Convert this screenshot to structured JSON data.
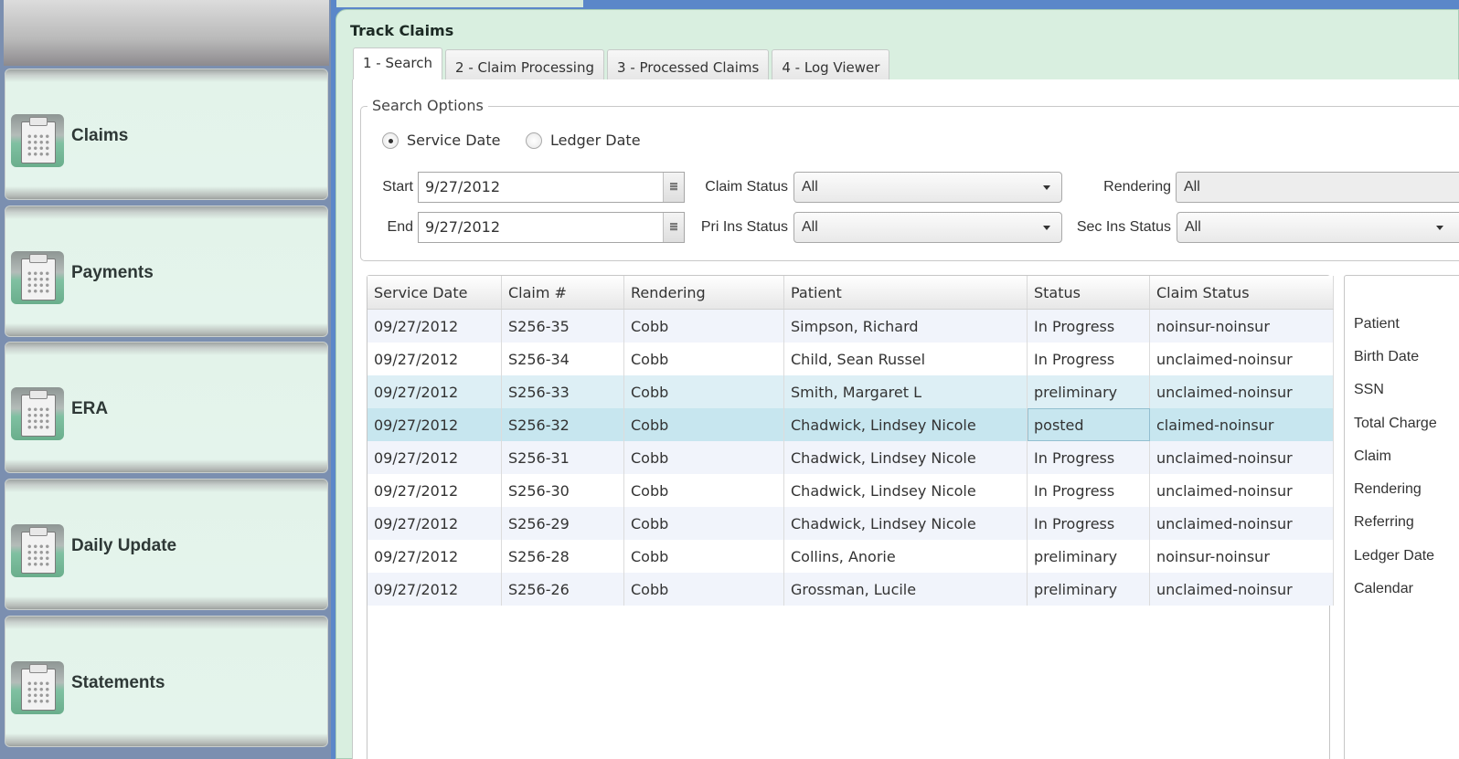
{
  "sidebar": {
    "items": [
      {
        "label": "Claims",
        "icon": "clipboard-calculator-icon"
      },
      {
        "label": "Payments",
        "icon": "clipboard-calculator-icon"
      },
      {
        "label": "ERA",
        "icon": "clipboard-calculator-icon"
      },
      {
        "label": "Daily Update",
        "icon": "clipboard-calculator-icon"
      },
      {
        "label": "Statements",
        "icon": "clipboard-calculator-icon"
      }
    ]
  },
  "panel": {
    "title": "Track Claims",
    "tabs": [
      {
        "label": "1 - Search",
        "active": true
      },
      {
        "label": "2 - Claim Processing",
        "active": false
      },
      {
        "label": "3 - Processed Claims",
        "active": false
      },
      {
        "label": "4 - Log Viewer",
        "active": false
      }
    ]
  },
  "search_options": {
    "legend": "Search Options",
    "date_type": {
      "options": [
        {
          "label": "Service Date",
          "selected": true
        },
        {
          "label": "Ledger Date",
          "selected": false
        }
      ]
    },
    "start_label": "Start",
    "start_value": "9/27/2012",
    "end_label": "End",
    "end_value": "9/27/2012",
    "claim_status_label": "Claim Status",
    "claim_status_value": "All",
    "pri_ins_status_label": "Pri Ins Status",
    "pri_ins_status_value": "All",
    "rendering_label": "Rendering",
    "rendering_value": "All",
    "sec_ins_status_label": "Sec Ins Status",
    "sec_ins_status_value": "All"
  },
  "claims_table": {
    "columns": [
      "Service Date",
      "Claim #",
      "Rendering",
      "Patient",
      "Status",
      "Claim Status"
    ],
    "rows": [
      {
        "service_date": "09/27/2012",
        "claim": "S256-35",
        "rendering": "Cobb",
        "patient": "Simpson, Richard",
        "status": "In Progress",
        "claim_status": "noinsur-noinsur"
      },
      {
        "service_date": "09/27/2012",
        "claim": "S256-34",
        "rendering": "Cobb",
        "patient": "Child, Sean Russel",
        "status": "In Progress",
        "claim_status": "unclaimed-noinsur"
      },
      {
        "service_date": "09/27/2012",
        "claim": "S256-33",
        "rendering": "Cobb",
        "patient": "Smith, Margaret L",
        "status": "preliminary",
        "claim_status": "unclaimed-noinsur"
      },
      {
        "service_date": "09/27/2012",
        "claim": "S256-32",
        "rendering": "Cobb",
        "patient": "Chadwick, Lindsey Nicole",
        "status": "posted",
        "claim_status": "claimed-noinsur"
      },
      {
        "service_date": "09/27/2012",
        "claim": "S256-31",
        "rendering": "Cobb",
        "patient": "Chadwick, Lindsey Nicole",
        "status": "In Progress",
        "claim_status": "unclaimed-noinsur"
      },
      {
        "service_date": "09/27/2012",
        "claim": "S256-30",
        "rendering": "Cobb",
        "patient": "Chadwick, Lindsey Nicole",
        "status": "In Progress",
        "claim_status": "unclaimed-noinsur"
      },
      {
        "service_date": "09/27/2012",
        "claim": "S256-29",
        "rendering": "Cobb",
        "patient": "Chadwick, Lindsey Nicole",
        "status": "In Progress",
        "claim_status": "unclaimed-noinsur"
      },
      {
        "service_date": "09/27/2012",
        "claim": "S256-28",
        "rendering": "Cobb",
        "patient": "Collins, Anorie",
        "status": "preliminary",
        "claim_status": "noinsur-noinsur"
      },
      {
        "service_date": "09/27/2012",
        "claim": "S256-26",
        "rendering": "Cobb",
        "patient": "Grossman, Lucile",
        "status": "preliminary",
        "claim_status": "unclaimed-noinsur"
      }
    ],
    "hover_row_index": 2,
    "selected_row_index": 3
  },
  "detail_panel": {
    "labels": [
      "Patient",
      "Birth Date",
      "SSN",
      "Total Charge",
      "Claim",
      "Rendering",
      "Referring",
      "Ledger Date",
      "Calendar"
    ]
  }
}
